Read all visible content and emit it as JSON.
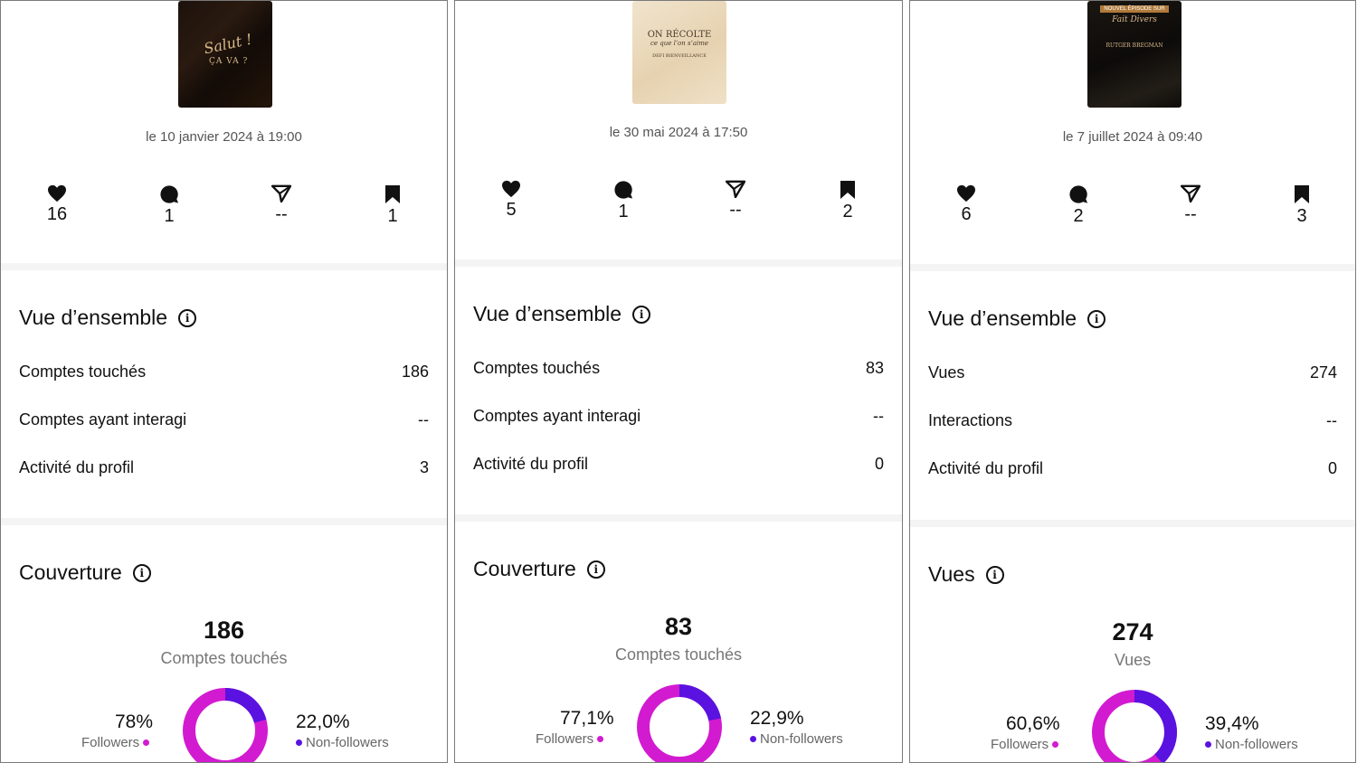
{
  "colors": {
    "followers": "#d21bd0",
    "non_followers": "#5a12e0",
    "text": "#111111",
    "muted": "#777777"
  },
  "panels": [
    {
      "cover_text": {
        "line1": "Salut !",
        "line2": "ÇA VA ?"
      },
      "date": "le 10 janvier 2024 à 19:00",
      "metrics": {
        "likes": "16",
        "comments": "1",
        "shares": "--",
        "saves": "1"
      },
      "overview_title": "Vue d’ensemble",
      "rows": [
        {
          "label": "Comptes touchés",
          "value": "186"
        },
        {
          "label": "Comptes ayant interagi",
          "value": "--"
        },
        {
          "label": "Activité du profil",
          "value": "3"
        }
      ],
      "coverage_title": "Couverture",
      "total": "186",
      "total_label": "Comptes touchés",
      "followers_pct": "78%",
      "followers_label": "Followers",
      "non_followers_pct": "22,0%",
      "non_followers_label": "Non-followers",
      "non_followers_fraction": 0.22
    },
    {
      "cover_text": {
        "line1": "ON RÉCOLTE",
        "line2": "ce que l’on s’aime",
        "line3": "DEFI BIENVEILLANCE"
      },
      "date": "le 30 mai 2024 à 17:50",
      "metrics": {
        "likes": "5",
        "comments": "1",
        "shares": "--",
        "saves": "2"
      },
      "overview_title": "Vue d’ensemble",
      "rows": [
        {
          "label": "Comptes touchés",
          "value": "83"
        },
        {
          "label": "Comptes ayant interagi",
          "value": "--"
        },
        {
          "label": "Activité du profil",
          "value": "0"
        }
      ],
      "coverage_title": "Couverture",
      "total": "83",
      "total_label": "Comptes touchés",
      "followers_pct": "77,1%",
      "followers_label": "Followers",
      "non_followers_pct": "22,9%",
      "non_followers_label": "Non-followers",
      "non_followers_fraction": 0.229
    },
    {
      "cover_text": {
        "line1": "NOUVEL ÉPISODE SUR",
        "line2": "Fait Divers",
        "line3": "RUTGER BREGMAN"
      },
      "date": "le 7 juillet 2024 à 09:40",
      "metrics": {
        "likes": "6",
        "comments": "2",
        "shares": "--",
        "saves": "3"
      },
      "overview_title": "Vue d’ensemble",
      "rows": [
        {
          "label": "Vues",
          "value": "274"
        },
        {
          "label": "Interactions",
          "value": "--"
        },
        {
          "label": "Activité du profil",
          "value": "0"
        }
      ],
      "coverage_title": "Vues",
      "total": "274",
      "total_label": "Vues",
      "followers_pct": "60,6%",
      "followers_label": "Followers",
      "non_followers_pct": "39,4%",
      "non_followers_label": "Non-followers",
      "non_followers_fraction": 0.394
    }
  ]
}
